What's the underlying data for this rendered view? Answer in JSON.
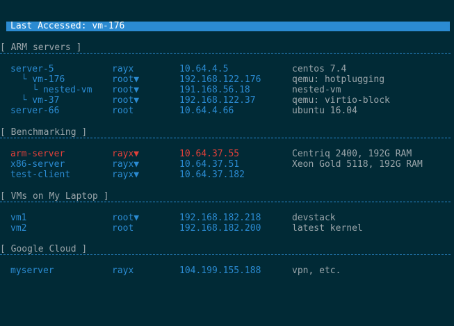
{
  "header": {
    "last_accessed_label": "Last Accessed:",
    "last_accessed_value": "vm-176"
  },
  "groups": [
    {
      "title": "[ ARM servers ]",
      "rows": [
        {
          "name": "server-5",
          "user": "rayx",
          "ip": "10.64.4.5",
          "desc": "centos 7.4"
        },
        {
          "name": "  └ vm-176",
          "user": "root▼",
          "ip": "192.168.122.176",
          "desc": "qemu: hotplugging"
        },
        {
          "name": "    └ nested-vm",
          "user": "root▼",
          "ip": "191.168.56.18",
          "desc": "nested-vm"
        },
        {
          "name": "  └ vm-37",
          "user": "root▼",
          "ip": "192.168.122.37",
          "desc": "qemu: virtio-block"
        },
        {
          "name": "server-66",
          "user": "root",
          "ip": "10.64.4.66",
          "desc": "ubuntu 16.04"
        }
      ]
    },
    {
      "title": "[ Benchmarking ]",
      "rows": [
        {
          "name": "arm-server",
          "user": "rayx▼",
          "ip": "10.64.37.55",
          "desc": "Centriq 2400, 192G RAM",
          "selected": true
        },
        {
          "name": "x86-server",
          "user": "rayx▼",
          "ip": "10.64.37.51",
          "desc": "Xeon Gold 5118, 192G RAM"
        },
        {
          "name": "test-client",
          "user": "rayx▼",
          "ip": "10.64.37.182",
          "desc": ""
        }
      ]
    },
    {
      "title": "[ VMs on My Laptop ]",
      "rows": [
        {
          "name": "vm1",
          "user": "root▼",
          "ip": "192.168.182.218",
          "desc": "devstack"
        },
        {
          "name": "vm2",
          "user": "root",
          "ip": "192.168.182.200",
          "desc": "latest kernel"
        }
      ]
    },
    {
      "title": "[ Google Cloud ]",
      "rows": [
        {
          "name": "myserver",
          "user": "rayx",
          "ip": "104.199.155.188",
          "desc": "vpn, etc."
        }
      ]
    }
  ],
  "colors": {
    "background": "#012a36",
    "accent": "#2b8bd2",
    "text": "#9aa5aa",
    "selected": "#e0403a"
  }
}
